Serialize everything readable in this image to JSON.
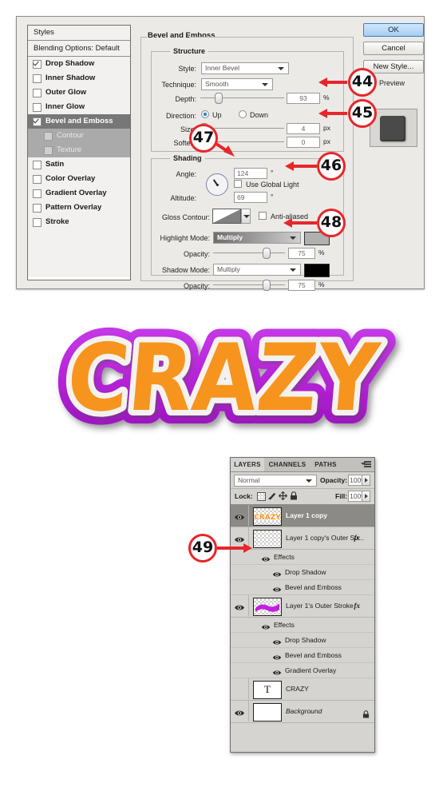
{
  "dialog": {
    "styles_panel": {
      "header": "Styles",
      "blending_options": "Blending Options: Default",
      "items": [
        {
          "label": "Drop Shadow",
          "checked": true,
          "selected": false,
          "sub": false
        },
        {
          "label": "Inner Shadow",
          "checked": false,
          "selected": false,
          "sub": false
        },
        {
          "label": "Outer Glow",
          "checked": false,
          "selected": false,
          "sub": false
        },
        {
          "label": "Inner Glow",
          "checked": false,
          "selected": false,
          "sub": false
        },
        {
          "label": "Bevel and Emboss",
          "checked": true,
          "selected": true,
          "sub": false
        },
        {
          "label": "Contour",
          "checked": false,
          "selected": false,
          "sub": true
        },
        {
          "label": "Texture",
          "checked": false,
          "selected": false,
          "sub": true
        },
        {
          "label": "Satin",
          "checked": false,
          "selected": false,
          "sub": false
        },
        {
          "label": "Color Overlay",
          "checked": false,
          "selected": false,
          "sub": false
        },
        {
          "label": "Gradient Overlay",
          "checked": false,
          "selected": false,
          "sub": false
        },
        {
          "label": "Pattern Overlay",
          "checked": false,
          "selected": false,
          "sub": false
        },
        {
          "label": "Stroke",
          "checked": false,
          "selected": false,
          "sub": false
        }
      ]
    },
    "bevel": {
      "title": "Bevel and Emboss",
      "structure": {
        "title": "Structure",
        "style_label": "Style:",
        "style_value": "Inner Bevel",
        "technique_label": "Technique:",
        "technique_value": "Smooth",
        "depth_label": "Depth:",
        "depth_value": "93",
        "depth_unit": "%",
        "direction_label": "Direction:",
        "direction_up": "Up",
        "direction_down": "Down",
        "direction_selected": "Up",
        "size_label": "Size:",
        "size_value": "4",
        "size_unit": "px",
        "soften_label": "Soften:",
        "soften_value": "0",
        "soften_unit": "px"
      },
      "shading": {
        "title": "Shading",
        "angle_label": "Angle:",
        "angle_value": "124",
        "angle_unit": "°",
        "use_global_light": "Use Global Light",
        "use_global_light_checked": false,
        "altitude_label": "Altitude:",
        "altitude_value": "69",
        "altitude_unit": "°",
        "gloss_contour_label": "Gloss Contour:",
        "anti_aliased": "Anti-aliased",
        "anti_aliased_checked": false,
        "highlight_mode_label": "Highlight Mode:",
        "highlight_mode_value": "Multiply",
        "highlight_color": "#b0b0b0",
        "highlight_opacity_label": "Opacity:",
        "highlight_opacity_value": "75",
        "highlight_opacity_unit": "%",
        "shadow_mode_label": "Shadow Mode:",
        "shadow_mode_value": "Multiply",
        "shadow_color": "#000000",
        "shadow_opacity_label": "Opacity:",
        "shadow_opacity_value": "75",
        "shadow_opacity_unit": "%"
      }
    },
    "buttons": {
      "ok": "OK",
      "cancel": "Cancel",
      "new_style": "New Style...",
      "preview": "Preview",
      "preview_checked": true
    }
  },
  "artwork": {
    "word": "CRAZY",
    "fill_color": "#f7941e",
    "stroke_color": "#f2f0ec",
    "outer_stroke_color": "#b726d9"
  },
  "layers_panel": {
    "tabs": [
      {
        "label": "LAYERS",
        "active": true
      },
      {
        "label": "CHANNELS",
        "active": false
      },
      {
        "label": "PATHS",
        "active": false
      }
    ],
    "blend_mode": "Normal",
    "opacity_label": "Opacity:",
    "opacity_value": "100%",
    "lock_label": "Lock:",
    "lock_icons": [
      "transparency-lock-icon",
      "brush-lock-icon",
      "move-lock-icon",
      "all-lock-icon"
    ],
    "fill_label": "Fill:",
    "fill_value": "100%",
    "rows": [
      {
        "type": "layer",
        "name": "Layer 1 copy",
        "visible": true,
        "selected": true,
        "fx": false,
        "thumb": "crazy-orange"
      },
      {
        "type": "layer",
        "name": "Layer 1 copy's Outer Str...",
        "visible": true,
        "selected": false,
        "fx": true,
        "fx_label": "fx",
        "thumb": "empty-checker"
      },
      {
        "type": "effects-group",
        "name": "Effects",
        "visible": true,
        "level": 1
      },
      {
        "type": "effect",
        "name": "Drop Shadow",
        "visible": true,
        "level": 2
      },
      {
        "type": "effect",
        "name": "Bevel and Emboss",
        "visible": true,
        "level": 2
      },
      {
        "type": "layer",
        "name": "Layer 1's Outer Stroke",
        "visible": true,
        "selected": false,
        "fx": true,
        "fx_label": "fx",
        "thumb": "purple-stroke"
      },
      {
        "type": "effects-group",
        "name": "Effects",
        "visible": true,
        "level": 1
      },
      {
        "type": "effect",
        "name": "Drop Shadow",
        "visible": true,
        "level": 2
      },
      {
        "type": "effect",
        "name": "Bevel and Emboss",
        "visible": true,
        "level": 2
      },
      {
        "type": "effect",
        "name": "Gradient Overlay",
        "visible": true,
        "level": 2
      },
      {
        "type": "layer",
        "name": "CRAZY",
        "visible": false,
        "selected": false,
        "fx": false,
        "thumb": "text-T"
      },
      {
        "type": "layer",
        "name": "Background",
        "visible": true,
        "selected": false,
        "fx": false,
        "thumb": "white",
        "locked": true,
        "italic": true
      }
    ]
  },
  "callouts": [
    {
      "id": "44",
      "target": "depth-field"
    },
    {
      "id": "45",
      "target": "size-field"
    },
    {
      "id": "46",
      "target": "use-global-light-checkbox"
    },
    {
      "id": "47",
      "target": "angle-field"
    },
    {
      "id": "48",
      "target": "highlight-color-swatch"
    },
    {
      "id": "49",
      "target": "layer-1-copy-thumbnail"
    }
  ],
  "colors": {
    "callout_red": "#e8262b",
    "dialog_bg": "#eceae6",
    "panel_bg": "#d6d4d0",
    "selected_row": "#8c8a86"
  }
}
